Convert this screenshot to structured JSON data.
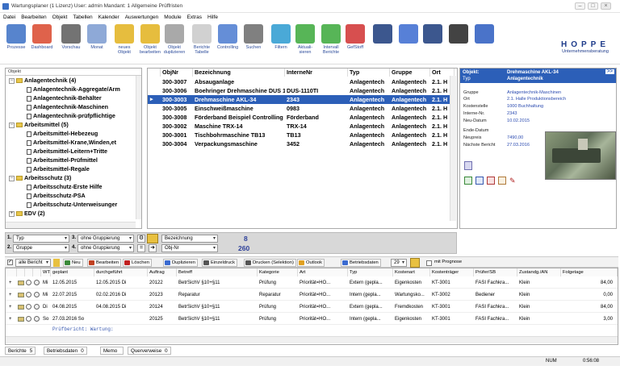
{
  "window": {
    "title": "Wartungsplaner (1 Lizenz)   User: admin   Mandant: 1 Allgemeine Prüffristen"
  },
  "menu": [
    "Datei",
    "Bearbeiten",
    "Objekt",
    "Tabellen",
    "Kalender",
    "Auswertungen",
    "Module",
    "Extras",
    "Hilfe"
  ],
  "toolbar": [
    {
      "label": "Prozesse",
      "icon": "processes-icon",
      "color": "#3a6fc4"
    },
    {
      "label": "Dashboard",
      "icon": "dashboard-icon",
      "color": "#d9472b"
    },
    {
      "label": "Vorschau",
      "icon": "preview-icon",
      "color": "#5a5a5a"
    },
    {
      "label": "Monat",
      "icon": "calendar-month-icon",
      "color": "#7a9ad0"
    },
    {
      "label": "neues Objekt",
      "icon": "new-object-icon",
      "color": "#e2b21c"
    },
    {
      "label": "Objekt bearbeiten",
      "icon": "edit-object-icon",
      "color": "#e2b21c"
    },
    {
      "label": "Objekt duplizieren",
      "icon": "duplicate-object-icon",
      "color": "#9a9a9a"
    },
    {
      "label": "Berichte Tabelle",
      "icon": "reports-table-icon",
      "color": "#c9c9c9"
    },
    {
      "label": "Controlling",
      "icon": "controlling-icon",
      "color": "#4a7ad0"
    },
    {
      "label": "Suchen",
      "icon": "search-icon",
      "color": "#6a6a6a"
    },
    {
      "label": "Filtern",
      "icon": "filter-icon",
      "color": "#2a9ad0"
    },
    {
      "label": "Aktuali-sieren",
      "icon": "refresh-icon",
      "color": "#3aa83a"
    },
    {
      "label": "Intervall Berichte",
      "icon": "interval-reports-icon",
      "color": "#3aa83a"
    },
    {
      "label": "GefStoff",
      "icon": "hazard-icon",
      "color": "#d03030"
    },
    {
      "label": "",
      "icon": "mobile-icon",
      "color": "#1a3a7a"
    },
    {
      "label": "",
      "icon": "barcode-icon",
      "color": "#3a6ad0"
    },
    {
      "label": "",
      "icon": "rfid-icon",
      "color": "#1a3a7a"
    },
    {
      "label": "",
      "icon": "camera-icon",
      "color": "#222"
    },
    {
      "label": "",
      "icon": "help-icon",
      "color": "#2a5ac0"
    }
  ],
  "logo": {
    "name": "HOPPE",
    "tagline": "Unternehmensberatung"
  },
  "tree": {
    "header": "Objekt",
    "items": [
      {
        "level": 0,
        "label": "Anlagentechnik  (4)",
        "type": "folder",
        "exp": "−"
      },
      {
        "level": 1,
        "label": "Anlagentechnik-Aggregate/Arm",
        "type": "doc"
      },
      {
        "level": 1,
        "label": "Anlagentechnik-Behälter",
        "type": "doc"
      },
      {
        "level": 1,
        "label": "Anlagentechnik-Maschinen",
        "type": "doc"
      },
      {
        "level": 1,
        "label": "Anlagentechnik-prüfpflichtige",
        "type": "doc"
      },
      {
        "level": 0,
        "label": "Arbeitsmittel  (5)",
        "type": "folder",
        "exp": "−"
      },
      {
        "level": 1,
        "label": "Arbeitsmittel-Hebezeug",
        "type": "doc"
      },
      {
        "level": 1,
        "label": "Arbeitsmittel-Krane,Winden,et",
        "type": "doc"
      },
      {
        "level": 1,
        "label": "Arbeitsmittel-Leitern+Tritte",
        "type": "doc"
      },
      {
        "level": 1,
        "label": "Arbeitsmittel-Prüfmittel",
        "type": "doc"
      },
      {
        "level": 1,
        "label": "Arbeitsmittel-Regale",
        "type": "doc"
      },
      {
        "level": 0,
        "label": "Arbeitsschutz  (3)",
        "type": "folder",
        "exp": "−"
      },
      {
        "level": 1,
        "label": "Arbeitsschutz-Erste Hilfe",
        "type": "doc"
      },
      {
        "level": 1,
        "label": "Arbeitsschutz-PSA",
        "type": "doc"
      },
      {
        "level": 1,
        "label": "Arbeitsschutz-Unterweisunger",
        "type": "doc"
      },
      {
        "level": 0,
        "label": "EDV  (2)",
        "type": "folder",
        "exp": "+"
      }
    ]
  },
  "grid": {
    "columns": [
      "ObjNr",
      "Bezeichnung",
      "InterneNr",
      "Typ",
      "Gruppe",
      "Ort"
    ],
    "rows": [
      [
        "300-3007",
        "Absauganlage",
        "",
        "Anlagentech",
        "Anlagentech",
        "2.1. H"
      ],
      [
        "300-3006",
        "Boehringer Drehmaschine DUS 11",
        "DUS-1110TI",
        "Anlagentech",
        "Anlagentech",
        "2.1. H"
      ],
      [
        "300-3003",
        "Drehmaschine AKL-34",
        "2343",
        "Anlagentech",
        "Anlagentech",
        "2.1. H"
      ],
      [
        "300-3005",
        "Einschweißmaschine",
        "0983",
        "Anlagentech",
        "Anlagentech",
        "2.1. H"
      ],
      [
        "300-3008",
        "Förderband Beispiel Controlling",
        "Förderband",
        "Anlagentech",
        "Anlagentech",
        "2.1. H"
      ],
      [
        "300-3002",
        "Maschine TRX-14",
        "TRX-14",
        "Anlagentech",
        "Anlagentech",
        "2.1. H"
      ],
      [
        "300-3001",
        "Tischbohrmaschine TB13",
        "TB13",
        "Anlagentech",
        "Anlagentech",
        "2.1. H"
      ],
      [
        "300-3004",
        "Verpackungsmaschine",
        "3452",
        "Anlagentech",
        "Anlagentech",
        "2.1. H"
      ]
    ],
    "selected_index": 2
  },
  "detail": {
    "header_label1": "Objekt:",
    "header_value1": "Drehmaschine AKL-34",
    "header_label2": "Typ",
    "header_value2": "Anlagentechnik",
    "expand": ">>",
    "fields": [
      {
        "label": "Gruppe",
        "value": "Anlagentechnik-Maschinen"
      },
      {
        "label": "Ort",
        "value": "2.1. Halle Produktionsbereich"
      },
      {
        "label": "Kostenstelle",
        "value": "1000 Buchhaltung"
      },
      {
        "label": "Interne-Nr.",
        "value": "2343"
      },
      {
        "label": "Neu-Datum",
        "value": "10.02.2015"
      },
      {
        "label": "Ende-Datum",
        "value": ""
      },
      {
        "label": "Neupreis",
        "value": "7490,00"
      },
      {
        "label": "Nächste Bericht",
        "value": "27.03.2016"
      }
    ]
  },
  "filter": {
    "row1": {
      "n": "1.",
      "field": "Typ",
      "n2": "3.",
      "group": "ohne Gruppierung",
      "sort": "Bezeichnung",
      "count": "8"
    },
    "row2": {
      "n": "2.",
      "field": "Gruppe",
      "n2": "4.",
      "group": "ohne Gruppierung",
      "sort": "Obj-Nr",
      "count": "260"
    }
  },
  "bottom_toolbar": {
    "alle": "alle Bericht",
    "buttons": [
      "Neu",
      "Bearbeiten",
      "Löschen",
      "Duplizieren",
      "Einzeldruck",
      "Drucken (Selektion)",
      "Outlook",
      "Betriebsdaten"
    ],
    "count": "29",
    "prognose": "mit Prognose"
  },
  "reports": {
    "columns": [
      "",
      "",
      "",
      "",
      "WT",
      "geplant",
      "durchgeführt",
      "Auftrag",
      "Betreff",
      "Kategorie",
      "Art",
      "Typ",
      "Kostenart",
      "Kostenträger",
      "Prüfer/SB",
      "Zustandg./AN",
      "Folgetage"
    ],
    "rows": [
      {
        "wt": "Mi",
        "geplant": "12.05.2015",
        "durch": "12.05.2015 Di",
        "auftrag": "20122",
        "betreff": "BetrSichV §10+§11",
        "kategorie": "Prüfung",
        "art": "Priorität=HO...",
        "typ": "Extern (gepla...",
        "kostenart": "Eigenkosten",
        "traeger": "KT-3001",
        "pruefer": "FASI Fachkra...",
        "zustand": "Klein",
        "folge": "84,00"
      },
      {
        "wt": "Mi",
        "geplant": "22.07.2015",
        "durch": "02.02.2016 Di",
        "auftrag": "20123",
        "betreff": "Reparatur",
        "kategorie": "Reparatur",
        "art": "Priorität=HO...",
        "typ": "Intern (gepla...",
        "kostenart": "Wartungsko...",
        "traeger": "KT-3002",
        "pruefer": "Bediener",
        "zustand": "Klein",
        "folge": "0,00"
      },
      {
        "wt": "Di",
        "geplant": "04.08.2015",
        "durch": "04.08.2015 Di",
        "auftrag": "20124",
        "betreff": "BetrSichV §10+§11",
        "kategorie": "Prüfung",
        "art": "Priorität=HO...",
        "typ": "Extern (gepla...",
        "kostenart": "Fremdkosten",
        "traeger": "KT-3001",
        "pruefer": "FASI Fachkra...",
        "zustand": "Klein",
        "folge": "84,00"
      },
      {
        "wt": "So",
        "geplant": "27.03.2016 So",
        "durch": "",
        "auftrag": "20125",
        "betreff": "BetrSichV §10+§11",
        "kategorie": "Prüfung",
        "art": "Priorität=HO...",
        "typ": "Intern (gepla...",
        "kostenart": "Eigenkosten",
        "traeger": "KT-3001",
        "pruefer": "FASI Fachkra...",
        "zustand": "Klein",
        "folge": "3,00"
      }
    ],
    "note": "Prüfbericht: Wartung:"
  },
  "tabs": [
    {
      "label": "Berichte",
      "count": "5"
    },
    {
      "label": "Betriebsdaten",
      "count": "0"
    },
    {
      "label": "Memo",
      "count": ""
    },
    {
      "label": "Querverweise",
      "count": "0"
    }
  ],
  "status": {
    "mode": "NUM",
    "time": "0:56:08"
  }
}
